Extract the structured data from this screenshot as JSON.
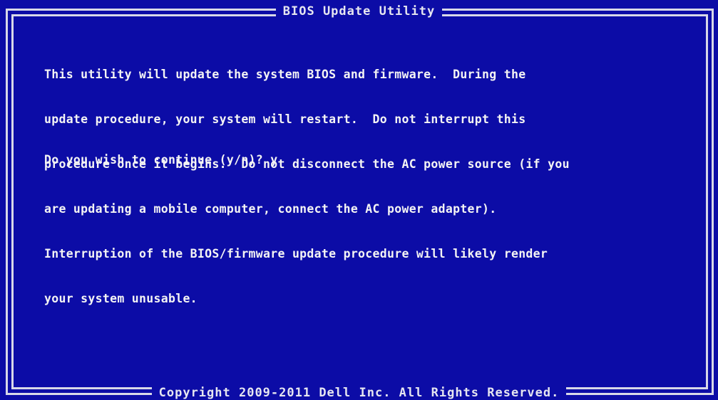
{
  "window": {
    "title": "BIOS Update Utility",
    "footer": "Copyright 2009-2011 Dell Inc.  All Rights Reserved."
  },
  "message": {
    "lines": [
      "This utility will update the system BIOS and firmware.  During the",
      "update procedure, your system will restart.  Do not interrupt this",
      "procedure once it begins.  Do not disconnect the AC power source (if you",
      "are updating a mobile computer, connect the AC power adapter).",
      "Interruption of the BIOS/firmware update procedure will likely render",
      "your system unusable."
    ]
  },
  "prompt": {
    "question": "Do you wish to continue (y/n)? ",
    "answer": "y"
  },
  "colors": {
    "background": "#0c0ca6",
    "text": "#f4f4f4",
    "frame": "#d8d8e8"
  }
}
